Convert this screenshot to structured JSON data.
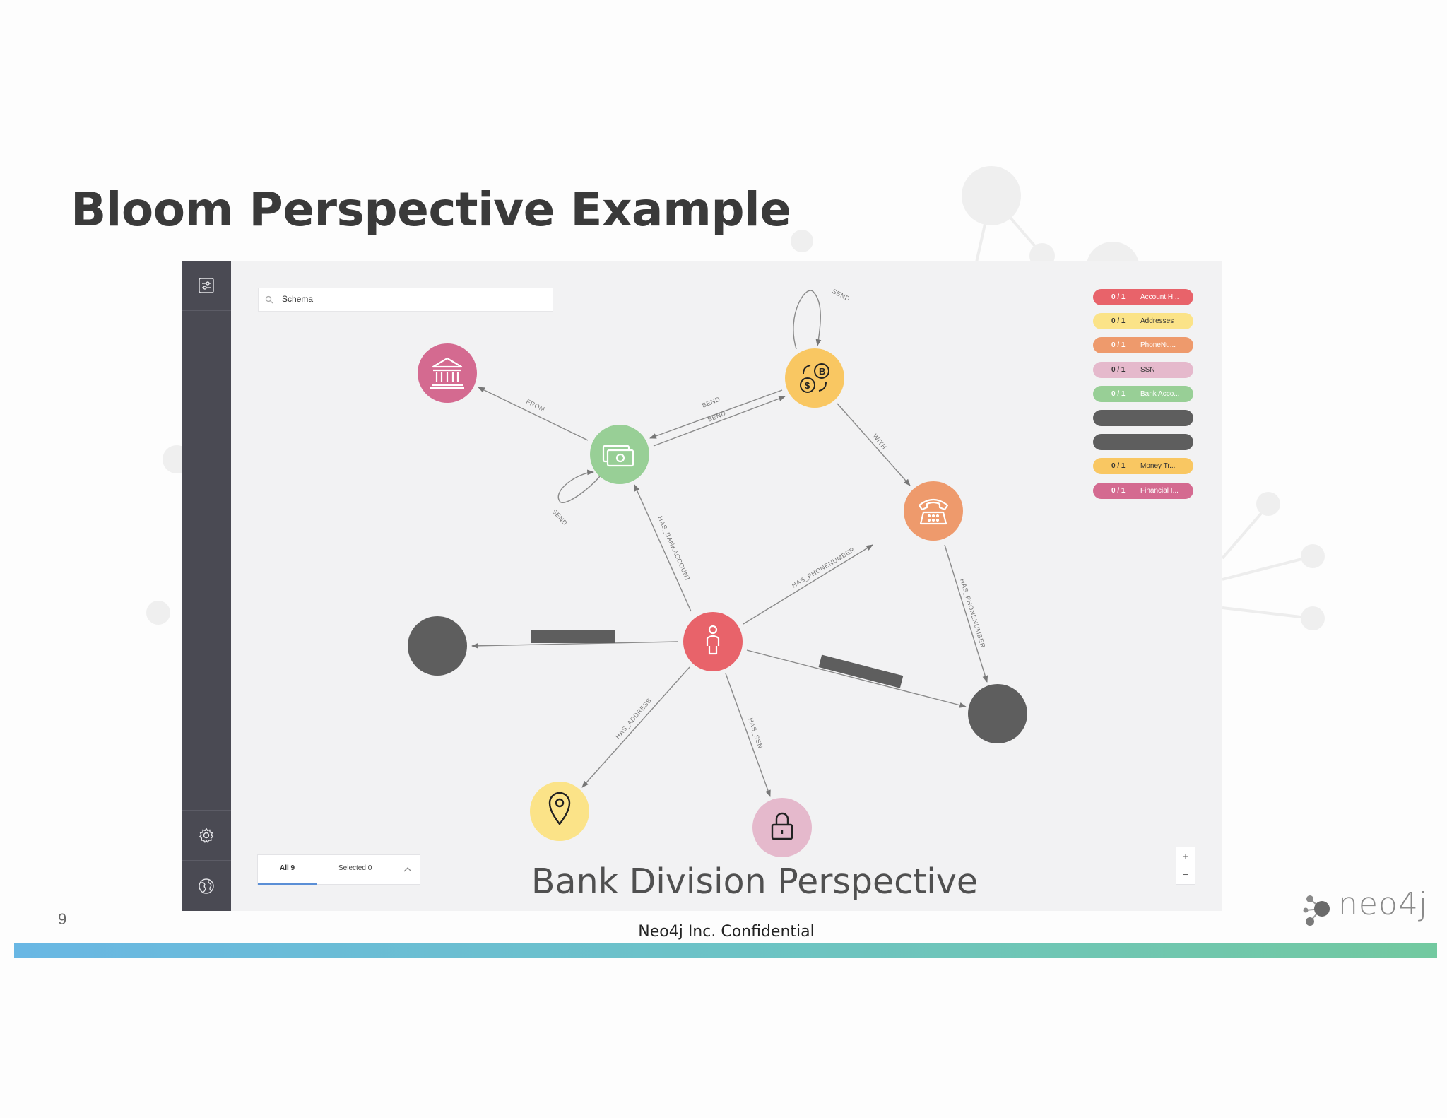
{
  "slide": {
    "title": "Bloom Perspective Example",
    "page_number": "9",
    "footer_text": "Neo4j Inc. Confidential",
    "logo_text": "neo4j"
  },
  "app": {
    "search": {
      "value": "Schema"
    },
    "perspective_label": "Bank Division Perspective",
    "legend": [
      {
        "count": "0 / 1",
        "name": "Account H...",
        "color": "#e8636a",
        "text_color": "#ffffff"
      },
      {
        "count": "0 / 1",
        "name": "Addresses",
        "color": "#fbe388",
        "text_color": "#333333"
      },
      {
        "count": "0 / 1",
        "name": "PhoneNu...",
        "color": "#ee9a6c",
        "text_color": "#ffffff"
      },
      {
        "count": "0 / 1",
        "name": "SSN",
        "color": "#e5b9cc",
        "text_color": "#333333"
      },
      {
        "count": "0 / 1",
        "name": "Bank Acco...",
        "color": "#98cf96",
        "text_color": "#ffffff"
      },
      {
        "count": "",
        "name": "",
        "color": "#5e5e5e",
        "text_color": "#ffffff"
      },
      {
        "count": "",
        "name": "",
        "color": "#5e5e5e",
        "text_color": "#ffffff"
      },
      {
        "count": "0 / 1",
        "name": "Money Tr...",
        "color": "#f9c762",
        "text_color": "#333333"
      },
      {
        "count": "0 / 1",
        "name": "Financial I...",
        "color": "#d46a90",
        "text_color": "#ffffff"
      }
    ],
    "tabs": {
      "all": "All 9",
      "selected": "Selected 0"
    },
    "zoom": {
      "in": "+",
      "out": "−"
    },
    "sidebar_icons": [
      "filter-panel-icon",
      "settings-icon",
      "globe-icon"
    ],
    "graph": {
      "nodes": [
        {
          "id": "bank",
          "icon": "bank-icon",
          "color": "#d46a90"
        },
        {
          "id": "money",
          "icon": "money-icon",
          "color": "#98cf96"
        },
        {
          "id": "exchange",
          "icon": "currency-exchange-icon",
          "color": "#f9c762"
        },
        {
          "id": "phone",
          "icon": "phone-icon",
          "color": "#ee9a6c"
        },
        {
          "id": "person",
          "icon": "person-icon",
          "color": "#e8636a"
        },
        {
          "id": "hidden-left",
          "icon": "",
          "color": "#5e5e5e"
        },
        {
          "id": "hidden-right",
          "icon": "",
          "color": "#5e5e5e"
        },
        {
          "id": "address",
          "icon": "location-pin-icon",
          "color": "#fbe388"
        },
        {
          "id": "ssn",
          "icon": "lock-icon",
          "color": "#e5b9cc"
        }
      ],
      "edge_labels": {
        "send_top": "SEND",
        "send_a": "SEND",
        "send_b": "SEND",
        "send_loop": "SEND",
        "from": "FROM",
        "with": "WITH",
        "has_bankaccount": "HAS_BANKACCOUNT",
        "has_phonenumber_a": "HAS_PHONENUMBER",
        "has_phonenumber_b": "HAS_PHONENUMBER",
        "has_address": "HAS_ADDRESS",
        "has_ssn": "HAS_SSN"
      }
    }
  }
}
